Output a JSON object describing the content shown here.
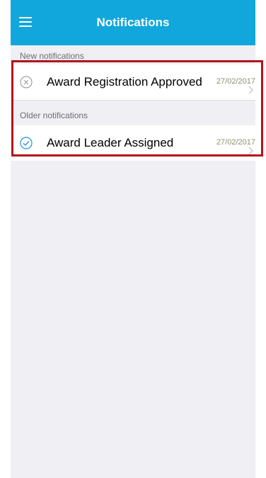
{
  "navbar": {
    "title": "Notifications",
    "menu_icon": "hamburger-menu-icon",
    "background": "#11a7dd"
  },
  "sections": [
    {
      "header": "New notifications",
      "items": [
        {
          "icon": "circle-x-icon",
          "title": "Award Registration Approved",
          "date": "27/02/2017"
        }
      ]
    },
    {
      "header": "Older notifications",
      "items": [
        {
          "icon": "circle-check-icon",
          "title": "Award Leader Assigned",
          "date": "27/02/2017"
        }
      ]
    }
  ],
  "colors": {
    "accent": "#11a7dd",
    "highlight_border": "#b5121b",
    "date_text": "#8c8f6e"
  }
}
